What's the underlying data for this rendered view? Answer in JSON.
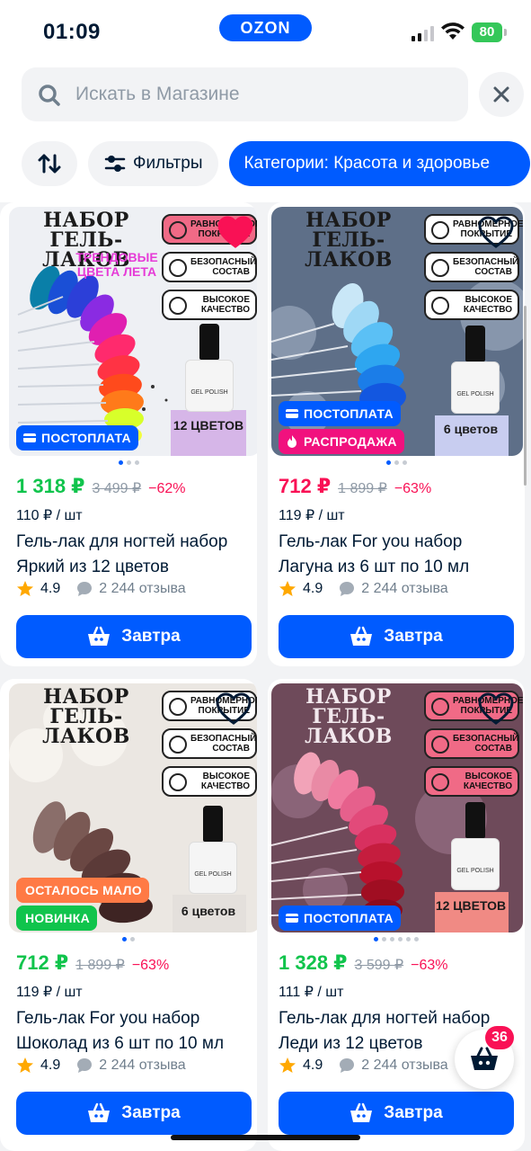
{
  "status_bar": {
    "time": "01:09",
    "app_logo": "OZON",
    "battery": "80"
  },
  "search": {
    "placeholder": "Искать в Магазине"
  },
  "filters": {
    "filters_label": "Фильтры",
    "category_label": "Категории: Красота и здоровье"
  },
  "products": [
    {
      "image": {
        "title": "НАБОР ГЕЛЬ-ЛАКОВ",
        "subtitle": "ТРЕНДОВЫЕ ЦВЕТА ЛЕТА",
        "features": [
          "РАВНОМЕРНОЕ ПОКРЫТИЕ",
          "БЕЗОПАСНЫЙ СОСТАВ",
          "ВЫСОКОЕ КАЧЕСТВО"
        ],
        "count_badge": "12 ЦВЕТОВ",
        "badges": [
          "ПОСТОПЛАТА"
        ],
        "favorited": true
      },
      "price": "1 318 ₽",
      "old_price": "3 499 ₽",
      "discount": "−62%",
      "unit_price": "110 ₽ / шт",
      "name": "Гель-лак для ногтей набор Яркий из 12 цветов",
      "rating": "4.9",
      "reviews": "2 244 отзыва",
      "button": "Завтра"
    },
    {
      "image": {
        "title": "НАБОР ГЕЛЬ-ЛАКОВ",
        "subtitle": "",
        "features": [
          "РАВНОМЕРНОЕ ПОКРЫТИЕ",
          "БЕЗОПАСНЫЙ СОСТАВ",
          "ВЫСОКОЕ КАЧЕСТВО"
        ],
        "count_badge": "6 цветов",
        "badges": [
          "ПОСТОПЛАТА",
          "РАСПРОДАЖА"
        ],
        "favorited": false
      },
      "price": "712 ₽",
      "old_price": "1 899 ₽",
      "discount": "−63%",
      "unit_price": "119 ₽ / шт",
      "name": "Гель-лак For you набор Лагуна из 6 шт по 10 мл",
      "rating": "4.9",
      "reviews": "2 244 отзыва",
      "button": "Завтра"
    },
    {
      "image": {
        "title": "НАБОР ГЕЛЬ-ЛАКОВ",
        "subtitle": "",
        "features": [
          "РАВНОМЕРНОЕ ПОКРЫТИЕ",
          "БЕЗОПАСНЫЙ СОСТАВ",
          "ВЫСОКОЕ КАЧЕСТВО"
        ],
        "count_badge": "6 цветов",
        "badges": [
          "ОСТАЛОСЬ МАЛО",
          "НОВИНКА"
        ],
        "favorited": false
      },
      "price": "712 ₽",
      "old_price": "1 899 ₽",
      "discount": "−63%",
      "unit_price": "119 ₽ / шт",
      "name": "Гель-лак For you набор Шоколад из 6 шт по 10 мл",
      "rating": "4.9",
      "reviews": "2 244 отзыва",
      "button": "Завтра"
    },
    {
      "image": {
        "title": "НАБОР ГЕЛЬ-ЛАКОВ",
        "subtitle": "",
        "features": [
          "РАВНОМЕРНОЕ ПОКРЫТИЕ",
          "БЕЗОПАСНЫЙ СОСТАВ",
          "ВЫСОКОЕ КАЧЕСТВО"
        ],
        "count_badge": "12 ЦВЕТОВ",
        "badges": [
          "ПОСТОПЛАТА"
        ],
        "favorited": false
      },
      "price": "1 328 ₽",
      "old_price": "3 599 ₽",
      "discount": "−63%",
      "unit_price": "111 ₽ / шт",
      "name": "Гель-лак для ногтей набор Леди из 12 цветов",
      "rating": "4.9",
      "reviews": "2 244 отзыва",
      "button": "Завтра"
    }
  ],
  "cart": {
    "count": "36"
  },
  "colors": {
    "accent": "#005bff",
    "price_green": "#10c44c",
    "discount_red": "#f91155"
  }
}
